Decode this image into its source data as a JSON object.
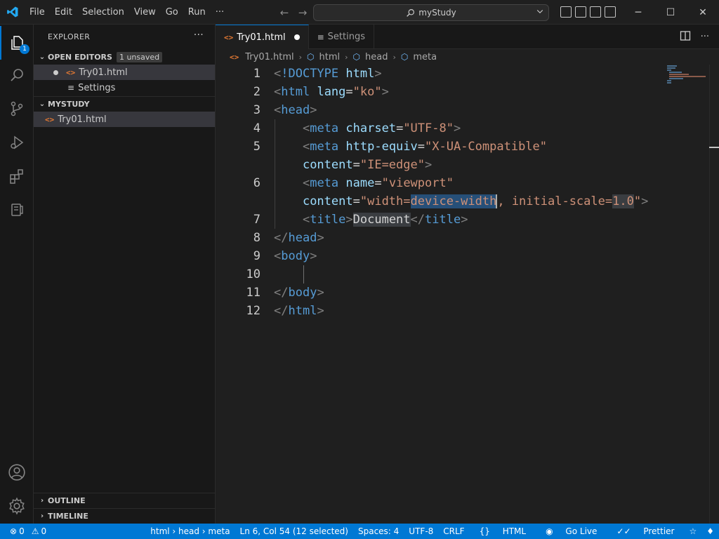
{
  "titlebar": {
    "menu": [
      "File",
      "Edit",
      "Selection",
      "View",
      "Go",
      "Run",
      "···"
    ],
    "search_text": "myStudy",
    "window_controls": [
      "─",
      "☐",
      "✕"
    ]
  },
  "activity": {
    "explorer_badge": "1",
    "icons": [
      "explorer-icon",
      "search-icon",
      "source-control-icon",
      "run-debug-icon",
      "extensions-icon",
      "remote-icon",
      "account-icon",
      "gear-icon"
    ]
  },
  "sidebar": {
    "title": "EXPLORER",
    "more": "···",
    "open_editors": {
      "label": "OPEN EDITORS",
      "unsaved_badge": "1 unsaved",
      "items": [
        {
          "name": "Try01.html",
          "modified": true
        },
        {
          "name": "Settings",
          "modified": false
        }
      ]
    },
    "folder": {
      "label": "MYSTUDY",
      "items": [
        {
          "name": "Try01.html"
        }
      ]
    },
    "outline_label": "OUTLINE",
    "timeline_label": "TIMELINE"
  },
  "tabs": [
    {
      "label": "Try01.html",
      "active": true,
      "modified": true
    },
    {
      "label": "Settings",
      "active": false,
      "modified": false
    }
  ],
  "breadcrumb": [
    "Try01.html",
    "html",
    "head",
    "meta"
  ],
  "editor": {
    "line_numbers": [
      "1",
      "2",
      "3",
      "4",
      "5",
      "6",
      "7",
      "8",
      "9",
      "10",
      "11",
      "12"
    ]
  },
  "statusbar": {
    "errors": "0",
    "warnings": "0",
    "path": "html › head › meta",
    "position": "Ln 6, Col 54 (12 selected)",
    "spaces": "Spaces: 4",
    "encoding": "UTF-8",
    "eol": "CRLF",
    "language": "HTML",
    "golive": "Go Live",
    "prettier": "Prettier"
  },
  "colors": {
    "accent": "#0078d4",
    "tag": "#569cd6",
    "attribute": "#9cdcfe",
    "string": "#ce9178",
    "html_icon": "#e37933"
  }
}
